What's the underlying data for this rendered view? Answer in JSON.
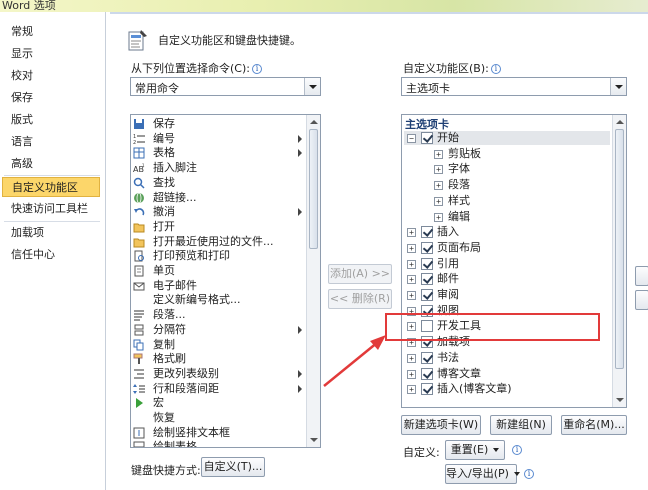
{
  "window": {
    "title": "Word 选项"
  },
  "nav": {
    "items": [
      {
        "label": "常规"
      },
      {
        "label": "显示"
      },
      {
        "label": "校对"
      },
      {
        "label": "保存"
      },
      {
        "label": "版式"
      },
      {
        "label": "语言"
      },
      {
        "label": "高级"
      },
      {
        "label": "自定义功能区",
        "active": true
      },
      {
        "label": "快速访问工具栏"
      },
      {
        "label": "加载项"
      },
      {
        "label": "信任中心"
      }
    ]
  },
  "header": {
    "text": "自定义功能区和键盘快捷键。"
  },
  "left": {
    "choose_label": "从下列位置选择命令(C):",
    "choose_value": "常用命令",
    "commands": [
      {
        "label": "保存",
        "icon": "save-icon",
        "submenu": false
      },
      {
        "label": "编号",
        "icon": "numbering-icon",
        "submenu": true
      },
      {
        "label": "表格",
        "icon": "table-icon",
        "submenu": true
      },
      {
        "label": "插入脚注",
        "icon": "footnote-icon",
        "submenu": false
      },
      {
        "label": "查找",
        "icon": "find-icon",
        "submenu": false
      },
      {
        "label": "超链接...",
        "icon": "hyperlink-icon",
        "submenu": false
      },
      {
        "label": "撤消",
        "icon": "undo-icon",
        "submenu": true
      },
      {
        "label": "打开",
        "icon": "open-folder-icon",
        "submenu": false
      },
      {
        "label": "打开最近使用过的文件...",
        "icon": "recent-file-icon",
        "submenu": false
      },
      {
        "label": "打印预览和打印",
        "icon": "print-preview-icon",
        "submenu": false
      },
      {
        "label": "单页",
        "icon": "single-page-icon",
        "submenu": false
      },
      {
        "label": "电子邮件",
        "icon": "email-icon",
        "submenu": false
      },
      {
        "label": "定义新编号格式...",
        "icon": "",
        "submenu": false
      },
      {
        "label": "段落...",
        "icon": "paragraph-icon",
        "submenu": false
      },
      {
        "label": "分隔符",
        "icon": "separator-icon",
        "submenu": true
      },
      {
        "label": "复制",
        "icon": "copy-icon",
        "submenu": false
      },
      {
        "label": "格式刷",
        "icon": "format-painter-icon",
        "submenu": false
      },
      {
        "label": "更改列表级别",
        "icon": "list-level-icon",
        "submenu": true
      },
      {
        "label": "行和段落间距",
        "icon": "line-spacing-icon",
        "submenu": true
      },
      {
        "label": "宏",
        "icon": "macro-icon",
        "submenu": false
      },
      {
        "label": "恢复",
        "icon": "",
        "submenu": false
      },
      {
        "label": "绘制竖排文本框",
        "icon": "vertical-textbox-icon",
        "submenu": false
      },
      {
        "label": "绘制表格",
        "icon": "draw-table-icon",
        "submenu": false
      }
    ],
    "keyboard_label": "键盘快捷方式:",
    "keyboard_button": "自定义(T)..."
  },
  "middle": {
    "add_button": "添加(A) >>",
    "remove_button": "<< 删除(R)"
  },
  "right": {
    "customize_label": "自定义功能区(B):",
    "customize_value": "主选项卡",
    "tree_title": "主选项卡",
    "tree": [
      {
        "label": "开始",
        "level": 0,
        "expanded": true,
        "checked": true,
        "hl": true
      },
      {
        "label": "剪贴板",
        "level": 1,
        "expanded": false,
        "checked": null
      },
      {
        "label": "字体",
        "level": 1,
        "expanded": false,
        "checked": null
      },
      {
        "label": "段落",
        "level": 1,
        "expanded": false,
        "checked": null
      },
      {
        "label": "样式",
        "level": 1,
        "expanded": false,
        "checked": null
      },
      {
        "label": "编辑",
        "level": 1,
        "expanded": false,
        "checked": null
      },
      {
        "label": "插入",
        "level": 0,
        "expanded": false,
        "checked": true
      },
      {
        "label": "页面布局",
        "level": 0,
        "expanded": false,
        "checked": true
      },
      {
        "label": "引用",
        "level": 0,
        "expanded": false,
        "checked": true
      },
      {
        "label": "邮件",
        "level": 0,
        "expanded": false,
        "checked": true
      },
      {
        "label": "审阅",
        "level": 0,
        "expanded": false,
        "checked": true
      },
      {
        "label": "视图",
        "level": 0,
        "expanded": false,
        "checked": true
      },
      {
        "label": "开发工具",
        "level": 0,
        "expanded": false,
        "checked": false
      },
      {
        "label": "加载项",
        "level": 0,
        "expanded": false,
        "checked": true
      },
      {
        "label": "书法",
        "level": 0,
        "expanded": false,
        "checked": true
      },
      {
        "label": "博客文章",
        "level": 0,
        "expanded": false,
        "checked": true
      },
      {
        "label": "插入(博客文章)",
        "level": 0,
        "expanded": false,
        "checked": true
      }
    ],
    "new_tab_button": "新建选项卡(W)",
    "new_group_button": "新建组(N)",
    "rename_button": "重命名(M)...",
    "customize2_label": "自定义:",
    "reset_button": "重置(E)",
    "import_export_button": "导入/导出(P)"
  },
  "colors": {
    "nav_active": "#fcd66a",
    "highlight_box": "#e23a3a",
    "tree_title": "#1e3f74"
  }
}
